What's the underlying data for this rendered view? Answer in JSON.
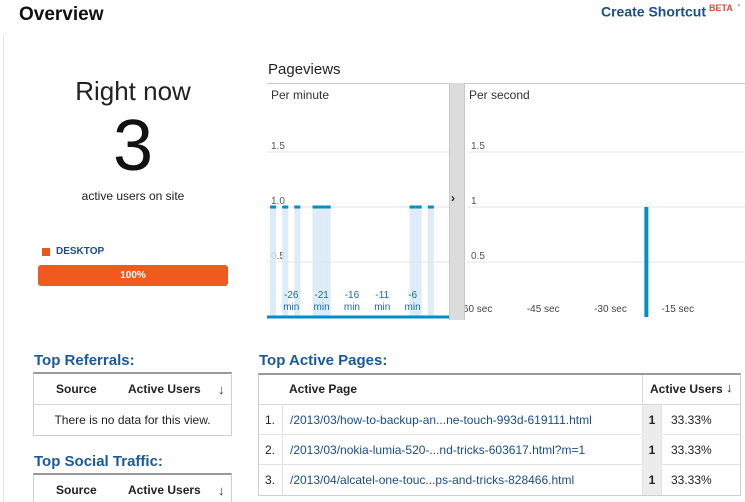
{
  "header": {
    "title": "Overview",
    "create_shortcut": "Create Shortcut",
    "beta": "BETA"
  },
  "right_now": {
    "label": "Right now",
    "count": "3",
    "subtitle": "active users on site"
  },
  "devices": {
    "legend": "DESKTOP",
    "percent_label": "100%",
    "fraction": 1.0,
    "color": "#f05a1e"
  },
  "pageviews": {
    "title": "Pageviews",
    "per_minute_label": "Per minute",
    "per_second_label": "Per second"
  },
  "chart_data": [
    {
      "type": "bar",
      "title": "Per minute",
      "ylim": [
        0,
        1.5
      ],
      "y_ticks": [
        "1.5",
        "1.0",
        "0.5"
      ],
      "x_ticks": [
        "-26\nmin",
        "-21\nmin",
        "-16\nmin",
        "-11\nmin",
        "-6\nmin",
        ""
      ],
      "x_tick_positions": [
        -26,
        -21,
        -16,
        -11,
        -6,
        -1
      ],
      "xlim": [
        -30,
        0
      ],
      "x": [
        -29,
        -28,
        -27,
        -26,
        -25,
        -24,
        -23,
        -22,
        -21,
        -20,
        -19,
        -18,
        -17,
        -16,
        -15,
        -14,
        -13,
        -12,
        -11,
        -10,
        -9,
        -8,
        -7,
        -6,
        -5,
        -4,
        -3,
        -2,
        -1
      ],
      "values": [
        1,
        0,
        1,
        0,
        1,
        0,
        0,
        1,
        1,
        1,
        0,
        0,
        0,
        0,
        0,
        0,
        0,
        0,
        0,
        0,
        0,
        0,
        0,
        1,
        1,
        0,
        1,
        0,
        0
      ],
      "color": "#058dc7"
    },
    {
      "type": "bar",
      "title": "Per second",
      "ylim": [
        0,
        1.5
      ],
      "y_ticks": [
        "1.5",
        "1",
        "0.5"
      ],
      "x_ticks": [
        "-60 sec",
        "-45 sec",
        "-30 sec",
        "-15 sec"
      ],
      "x_tick_positions": [
        -60,
        -45,
        -30,
        -15
      ],
      "xlim": [
        -62,
        0
      ],
      "x": [
        -22
      ],
      "values": [
        1
      ],
      "color": "#058dc7"
    }
  ],
  "top_referrals": {
    "title": "Top Referrals:",
    "col_source": "Source",
    "col_users": "Active Users",
    "sort_icon": "↓",
    "empty_text": "There is no data for this view."
  },
  "top_social": {
    "title": "Top Social Traffic:",
    "col_source": "Source",
    "col_users": "Active Users",
    "sort_icon": "↓"
  },
  "top_pages": {
    "title": "Top Active Pages:",
    "col_page": "Active Page",
    "col_users": "Active Users",
    "sort_icon": "↓",
    "rows": [
      {
        "idx": "1.",
        "page": "/2013/03/how-to-backup-an...ne-touch-993d-619111.html",
        "count": "1",
        "pct": "33.33%"
      },
      {
        "idx": "2.",
        "page": "/2013/03/nokia-lumia-520-...nd-tricks-603617.html?m=1",
        "count": "1",
        "pct": "33.33%"
      },
      {
        "idx": "3.",
        "page": "/2013/04/alcatel-one-touc...ps-and-tricks-828466.html",
        "count": "1",
        "pct": "33.33%"
      }
    ]
  }
}
